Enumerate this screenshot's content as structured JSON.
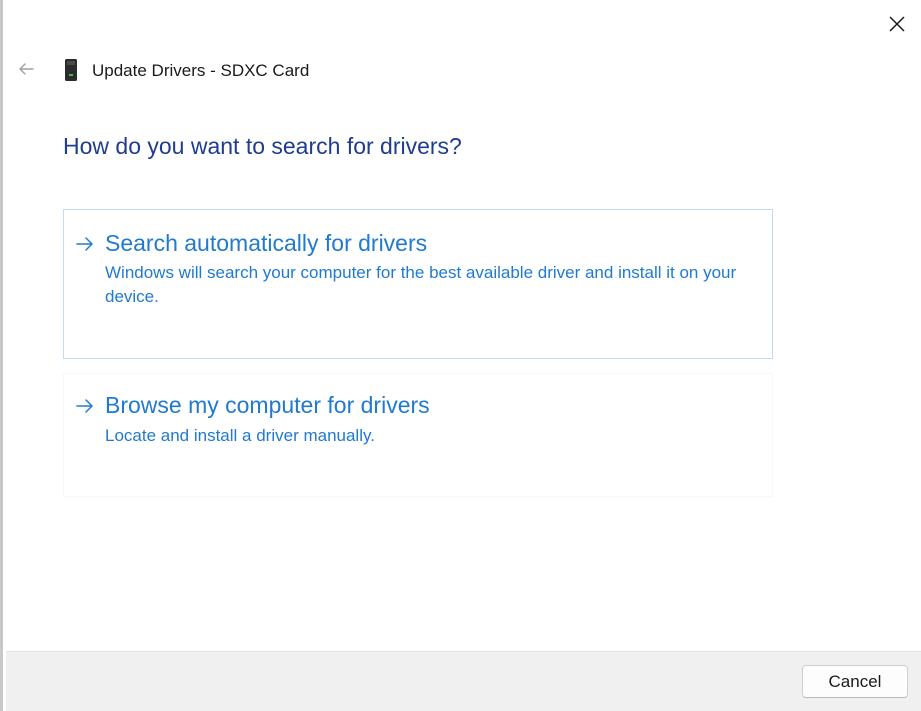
{
  "window": {
    "title": "Update Drivers - SDXC Card",
    "close_icon": "close-icon",
    "back_icon": "back-arrow-icon",
    "device_icon": "sd-card-icon"
  },
  "main": {
    "question": "How do you want to search for drivers?",
    "options": [
      {
        "icon": "right-arrow-icon",
        "title": "Search automatically for drivers",
        "description": "Windows will search your computer for the best available driver and install it on your device."
      },
      {
        "icon": "right-arrow-icon",
        "title": "Browse my computer for drivers",
        "description": "Locate and install a driver manually."
      }
    ]
  },
  "footer": {
    "cancel_label": "Cancel"
  },
  "colors": {
    "heading": "#1f3d8f",
    "link": "#1f7ad0",
    "option_border": "#bfdcf2",
    "footer_bg": "#f0f0f0"
  }
}
